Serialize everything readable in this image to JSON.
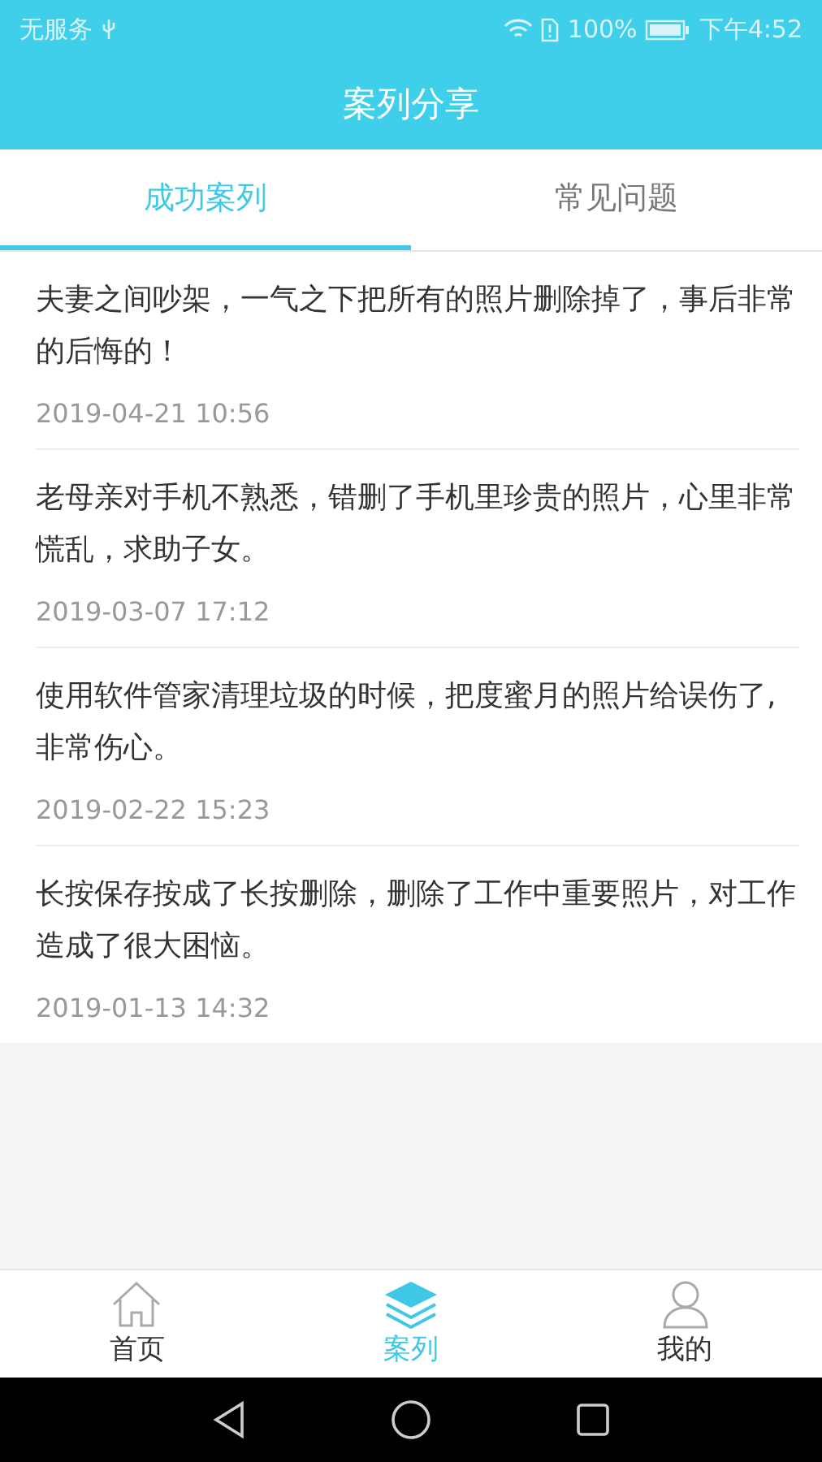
{
  "status_bar": {
    "carrier": "无服务",
    "battery": "100%",
    "time": "下午4:52"
  },
  "title": "案列分享",
  "tabs": [
    {
      "label": "成功案列",
      "selected": true
    },
    {
      "label": "常见问题",
      "selected": false
    }
  ],
  "cases": [
    {
      "text": "夫妻之间吵架，一气之下把所有的照片删除掉了，事后非常的后悔的！",
      "date": "2019-04-21 10:56"
    },
    {
      "text": "老母亲对手机不熟悉，错删了手机里珍贵的照片，心里非常慌乱，求助子女。",
      "date": "2019-03-07 17:12"
    },
    {
      "text": "使用软件管家清理垃圾的时候，把度蜜月的照片给误伤了,非常伤心。",
      "date": "2019-02-22 15:23"
    },
    {
      "text": "长按保存按成了长按删除，删除了工作中重要照片，对工作造成了很大困恼。",
      "date": "2019-01-13 14:32"
    }
  ],
  "bottom_nav": [
    {
      "kind": "home",
      "label": "首页",
      "selected": false
    },
    {
      "kind": "layers",
      "label": "案列",
      "selected": true
    },
    {
      "kind": "person",
      "label": "我的",
      "selected": false
    }
  ]
}
